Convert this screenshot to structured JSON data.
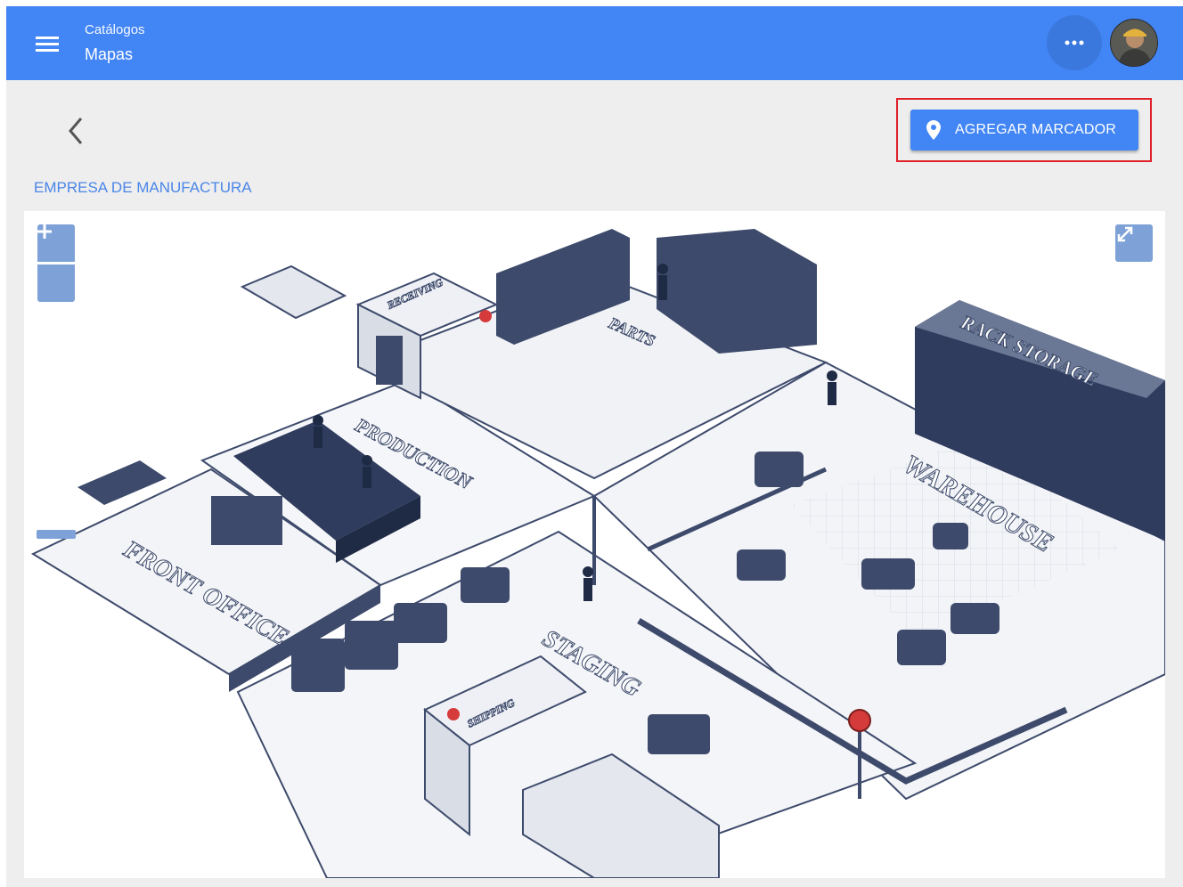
{
  "appbar": {
    "breadcrumb": "Catálogos",
    "title": "Mapas",
    "menu_icon": "menu-icon",
    "more_icon": "more-horizontal-icon",
    "avatar": "user-avatar"
  },
  "toolbar": {
    "back_icon": "chevron-left-icon",
    "add_marker_label": "AGREGAR MARCADOR",
    "add_marker_icon": "location-pin-icon"
  },
  "company_name": "EMPRESA DE MANUFACTURA",
  "map": {
    "zoom_in_icon": "plus-icon",
    "zoom_out_icon": "minus-icon",
    "fullscreen_icon": "expand-icon",
    "floor_labels": {
      "receiving": "RECEIVING",
      "parts": "PARTS",
      "rack_storage": "RACK STORAGE",
      "production": "PRODUCTION",
      "warehouse": "WAREHOUSE",
      "front_office": "FRONT OFFICE",
      "staging": "STAGING",
      "shipping": "SHIPPING"
    }
  },
  "colors": {
    "primary": "#4285f4",
    "highlight": "#e0212b",
    "control": "#7ea2d8",
    "link": "#4a86e8"
  }
}
